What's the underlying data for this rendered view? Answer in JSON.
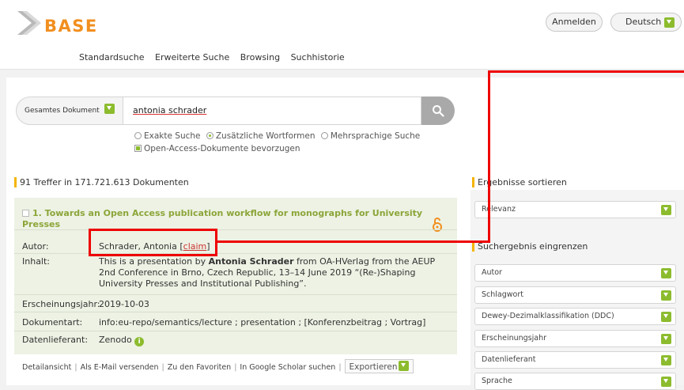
{
  "header": {
    "logo_text": "BASE",
    "login_label": "Anmelden",
    "language_label": "Deutsch",
    "nav": [
      "Standardsuche",
      "Erweiterte Suche",
      "Browsing",
      "Suchhistorie"
    ]
  },
  "search": {
    "scope_label": "Gesamtes Dokument",
    "query": "antonia schrader",
    "options": [
      "Exakte Suche",
      "Zusätzliche Wortformen",
      "Mehrsprachige Suche"
    ],
    "selected_option": "Zusätzliche Wortformen",
    "open_access_label": "Open-Access-Dokumente bevorzugen"
  },
  "results": {
    "hits_text": "91 Treffer in 171.721.613 Dokumenten",
    "items": [
      {
        "title": "1. Towards an Open Access publication workflow for monographs for University Presses",
        "fields": {
          "author_label": "Autor:",
          "author_value": "Schrader, Antonia",
          "claim_label": "claim",
          "content_label": "Inhalt:",
          "content_pre": "This is a presentation by ",
          "content_bold": "Antonia Schrader",
          "content_post": " from OA-HVerlag from the AEUP 2nd Conference in Brno, Czech Republic, 13–14 June 2019 “(Re-)Shaping University Presses and Institutional Publishing”.",
          "year_label": "Erscheinungsjahr:",
          "year_value": "2019-10-03",
          "doctype_label": "Dokumentart:",
          "doctype_value": "info:eu-repo/semantics/lecture ; presentation ; [Konferenzbeitrag ; Vortrag]",
          "provider_label": "Datenlieferant:",
          "provider_value": "Zenodo"
        },
        "links": [
          "Detailansicht",
          "Als E-Mail versenden",
          "Zu den Favoriten",
          "In Google Scholar suchen"
        ],
        "export_label": "Exportieren"
      }
    ]
  },
  "sidebar": {
    "sort_heading": "Ergebnisse sortieren",
    "sort_value": "Relevanz",
    "filter_heading": "Suchergebnis eingrenzen",
    "filters": [
      "Autor",
      "Schlagwort",
      "Dewey-Dezimalklassifikation (DDC)",
      "Erscheinungsjahr",
      "Datenlieferant",
      "Sprache"
    ]
  },
  "colors": {
    "accent_green": "#8cbc2e",
    "title_green": "#8ca539",
    "logo_orange": "#f18f1f",
    "annotation_red": "#e00000"
  }
}
